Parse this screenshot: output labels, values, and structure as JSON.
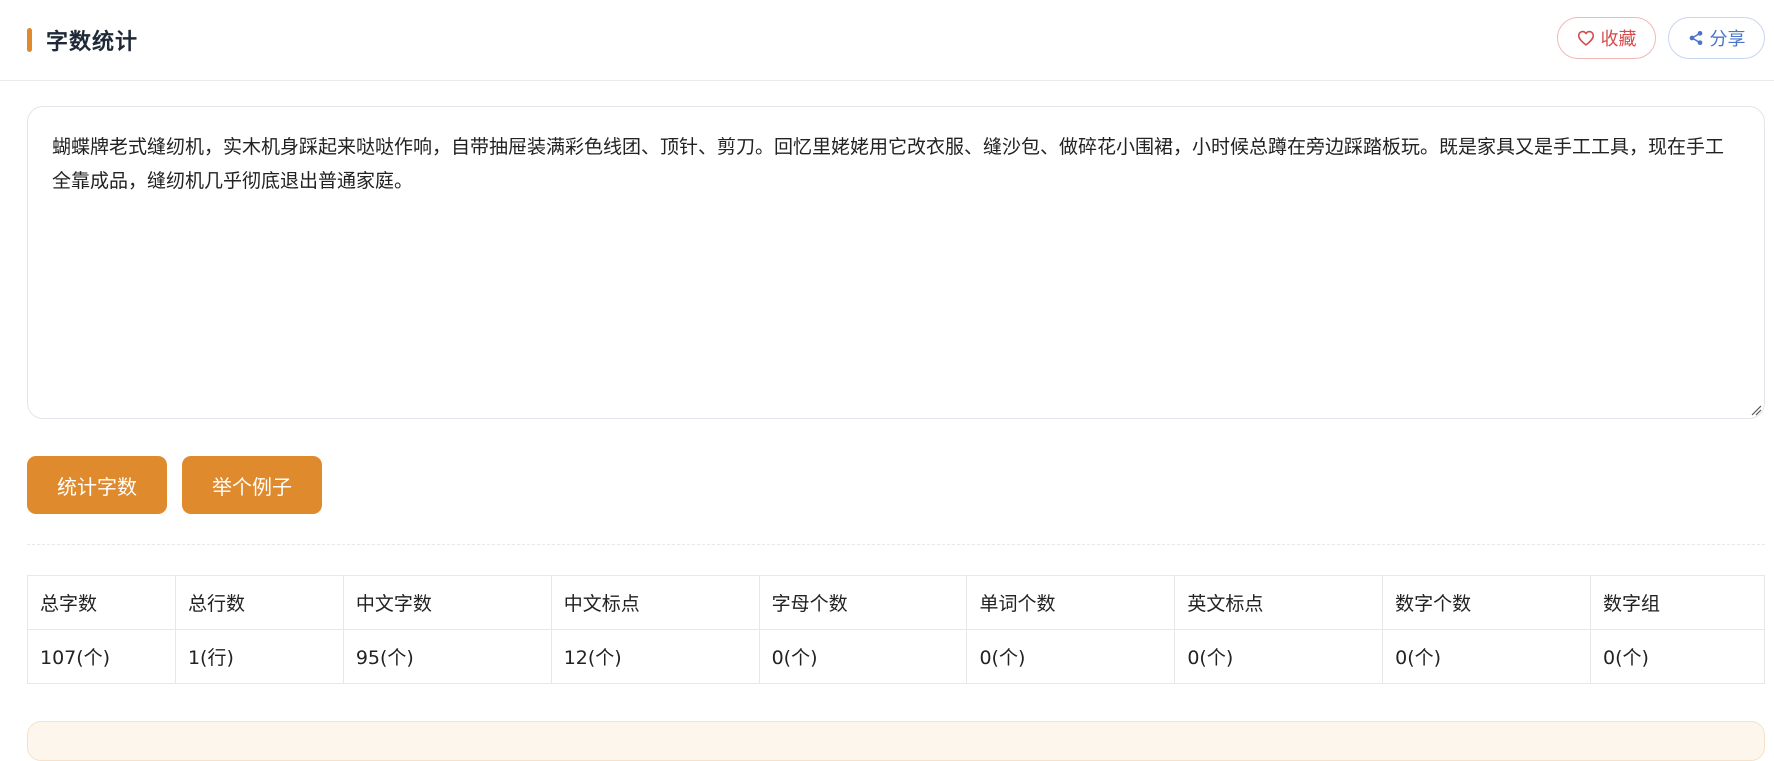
{
  "header": {
    "title": "字数统计",
    "favorite_label": "收藏",
    "share_label": "分享"
  },
  "editor": {
    "value": "蝴蝶牌老式缝纫机，实木机身踩起来哒哒作响，自带抽屉装满彩色线团、顶针、剪刀。回忆里姥姥用它改衣服、缝沙包、做碎花小围裙，小时候总蹲在旁边踩踏板玩。既是家具又是手工工具，现在手工全靠成品，缝纫机几乎彻底退出普通家庭。"
  },
  "actions": {
    "count_label": "统计字数",
    "example_label": "举个例子"
  },
  "stats": {
    "headers": [
      "总字数",
      "总行数",
      "中文字数",
      "中文标点",
      "字母个数",
      "单词个数",
      "英文标点",
      "数字个数",
      "数字组"
    ],
    "values": [
      "107(个)",
      "1(行)",
      "95(个)",
      "12(个)",
      "0(个)",
      "0(个)",
      "0(个)",
      "0(个)",
      "0(个)"
    ]
  },
  "colors": {
    "accent": "#e08a2e",
    "favorite": "#d44c4c",
    "share": "#4a74c9"
  },
  "icons": {
    "favorite": "heart-icon",
    "share": "share-icon"
  }
}
